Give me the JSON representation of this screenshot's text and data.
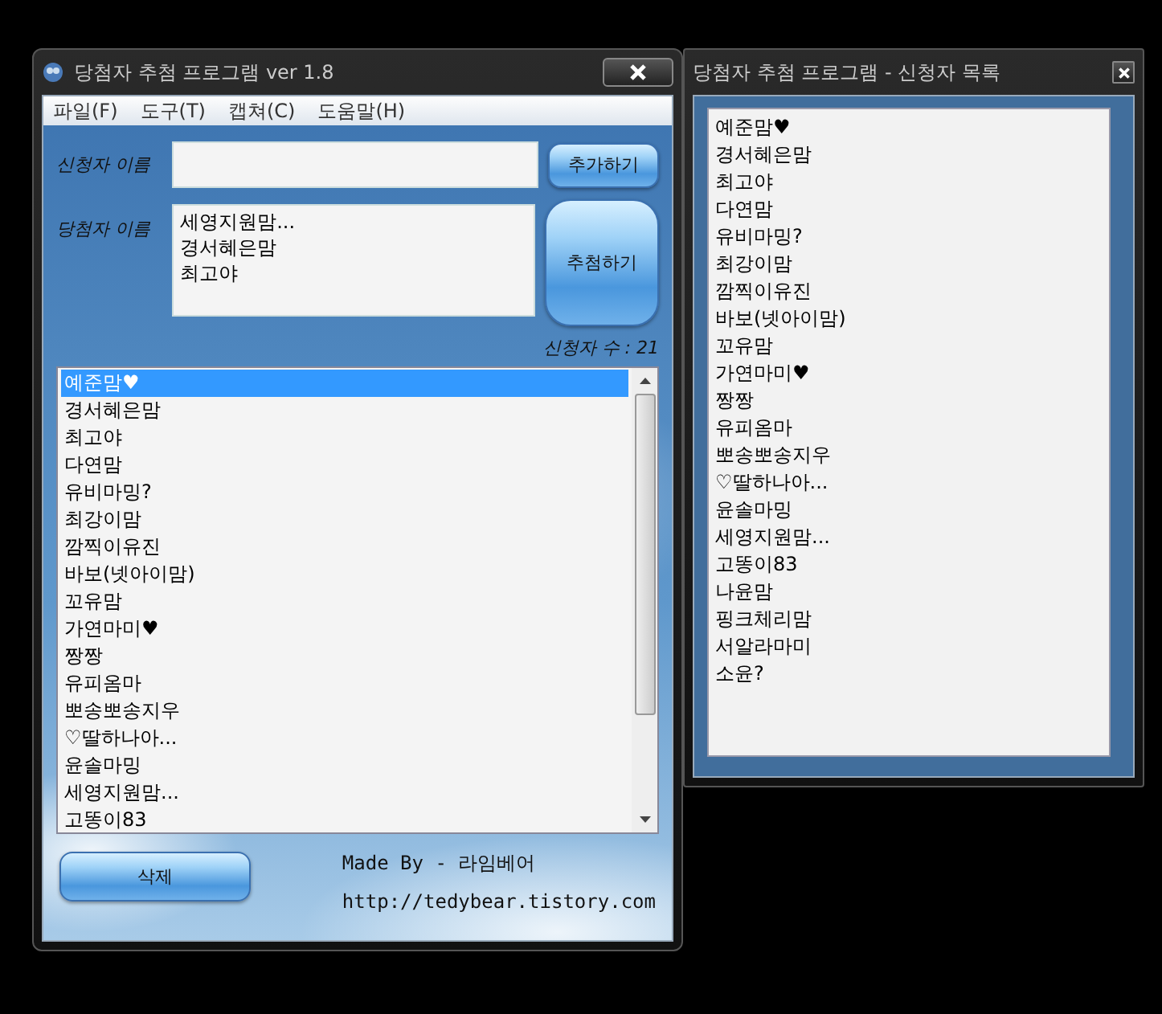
{
  "main_window": {
    "title": "당첨자 추첨 프로그램 ver 1.8",
    "menu": [
      "파일(F)",
      "도구(T)",
      "캡쳐(C)",
      "도움말(H)"
    ],
    "applicant_label": "신청자 이름",
    "add_button": "추가하기",
    "winner_label": "당첨자 이름",
    "winners": [
      "세영지원맘...",
      "경서혜은맘",
      "최고야"
    ],
    "draw_button": "추첨하기",
    "count_label": "신청자 수 : 21",
    "applicants": [
      {
        "name": "예준맘♥",
        "selected": true
      },
      {
        "name": "경서혜은맘",
        "selected": false
      },
      {
        "name": "최고야",
        "selected": false
      },
      {
        "name": "다연맘",
        "selected": false
      },
      {
        "name": "유비마밍?",
        "selected": false
      },
      {
        "name": "최강이맘",
        "selected": false
      },
      {
        "name": "깜찍이유진",
        "selected": false
      },
      {
        "name": "바보(넷아이맘)",
        "selected": false
      },
      {
        "name": "꼬유맘",
        "selected": false
      },
      {
        "name": "가연마미♥",
        "selected": false
      },
      {
        "name": "짱짱",
        "selected": false
      },
      {
        "name": "유피옴마",
        "selected": false
      },
      {
        "name": "뽀송뽀송지우",
        "selected": false
      },
      {
        "name": "♡딸하나아...",
        "selected": false
      },
      {
        "name": "윤솔마밍",
        "selected": false
      },
      {
        "name": "세영지원맘...",
        "selected": false
      },
      {
        "name": "고똥이83",
        "selected": false
      }
    ],
    "delete_button": "삭제",
    "credit": "Made By - 라임베어",
    "url": "http://tedybear.tistory.com"
  },
  "list_window": {
    "title": "당첨자 추첨 프로그램 - 신청자 목록",
    "items": [
      "예준맘♥",
      "경서혜은맘",
      "최고야",
      "다연맘",
      "유비마밍?",
      "최강이맘",
      "깜찍이유진",
      "바보(넷아이맘)",
      "꼬유맘",
      "가연마미♥",
      "짱짱",
      "유피옴마",
      "뽀송뽀송지우",
      "♡딸하나아...",
      "윤솔마밍",
      "세영지원맘...",
      "고똥이83",
      "나윤맘",
      "핑크체리맘",
      "서알라마미",
      "소윤?"
    ]
  }
}
